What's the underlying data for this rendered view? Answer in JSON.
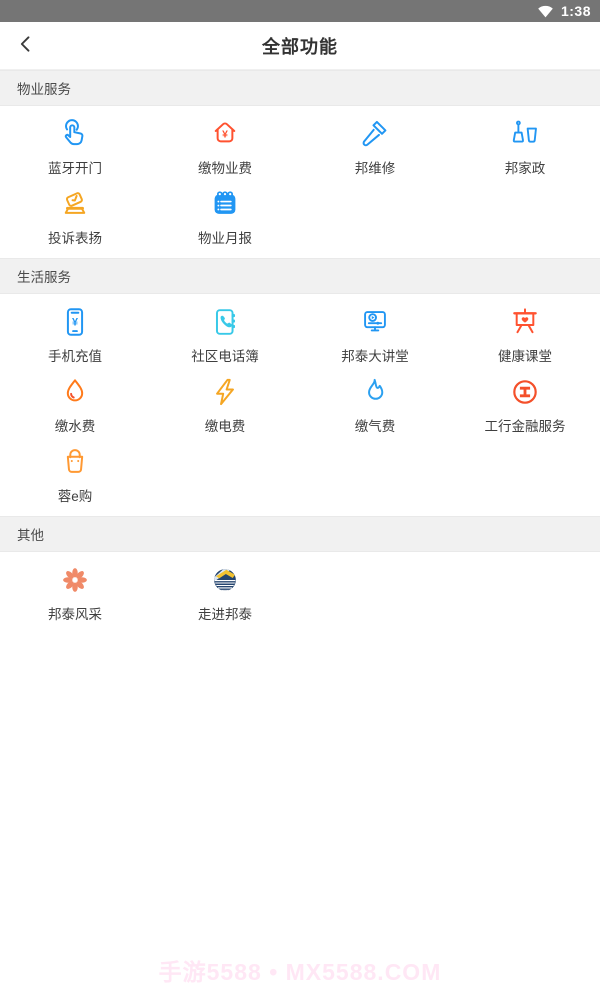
{
  "status_bar": {
    "time": "1:38",
    "wifi_icon": "wifi-icon",
    "bg_color": "#757575"
  },
  "nav": {
    "title": "全部功能",
    "back_icon": "chevron-left-icon"
  },
  "colors": {
    "accent_blue": "#2196F3",
    "accent_cyan": "#38C9E8",
    "accent_red_orange": "#FF5230",
    "accent_amber": "#F5A623",
    "accent_orange": "#FF9933",
    "accent_coral": "#F08A68",
    "logo_navy": "#25456F",
    "section_header_bg": "#F1F1F1",
    "watermark_pink": "#FFE7F5"
  },
  "sections": [
    {
      "title": "物业服务",
      "items": [
        {
          "label": "蓝牙开门",
          "icon": "tap-icon",
          "color": "#2196F3"
        },
        {
          "label": "缴物业费",
          "icon": "house-yen-icon",
          "color": "#FF5230"
        },
        {
          "label": "邦维修",
          "icon": "hammer-icon",
          "color": "#2196F3"
        },
        {
          "label": "邦家政",
          "icon": "broom-bucket-icon",
          "color": "#2196F3"
        },
        {
          "label": "投诉表扬",
          "icon": "ballot-box-icon",
          "color": "#F5A623"
        },
        {
          "label": "物业月报",
          "icon": "notepad-icon",
          "color": "#2196F3"
        }
      ]
    },
    {
      "title": "生活服务",
      "items": [
        {
          "label": "手机充值",
          "icon": "phone-recharge-icon",
          "color": "#2196F3"
        },
        {
          "label": "社区电话簿",
          "icon": "phonebook-icon",
          "color": "#38C9E8"
        },
        {
          "label": "邦泰大讲堂",
          "icon": "video-lecture-icon",
          "color": "#2196F3"
        },
        {
          "label": "健康课堂",
          "icon": "health-board-icon",
          "color": "#FF5230"
        },
        {
          "label": "缴水费",
          "icon": "water-drop-icon",
          "color": "#FF7A1A"
        },
        {
          "label": "缴电费",
          "icon": "lightning-icon",
          "color": "#F5A623"
        },
        {
          "label": "缴气费",
          "icon": "flame-icon",
          "color": "#2196F3"
        },
        {
          "label": "工行金融服务",
          "icon": "icbc-logo-icon",
          "color": "#F4502A"
        },
        {
          "label": "蓉e购",
          "icon": "shopping-bag-icon",
          "color": "#FF9933"
        }
      ]
    },
    {
      "title": "其他",
      "items": [
        {
          "label": "邦泰风采",
          "icon": "flower-icon",
          "color": "#F08A68"
        },
        {
          "label": "走进邦泰",
          "icon": "bangtai-logo-icon",
          "color": "#25456F"
        }
      ]
    }
  ],
  "watermark": {
    "text": "手游5588 • MX5588.COM"
  }
}
